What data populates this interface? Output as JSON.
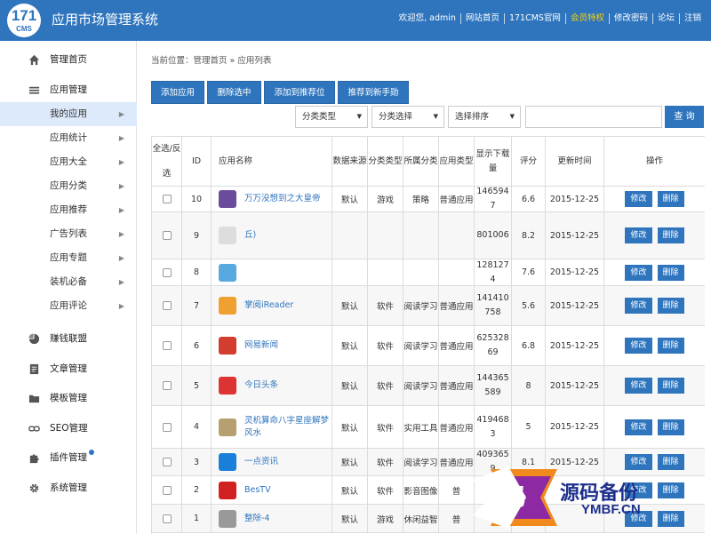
{
  "header": {
    "logo_number": "171",
    "logo_sub": "CMS",
    "title": "应用市场管理系统",
    "nav": [
      "欢迎您, admin",
      "网站首页",
      "171CMS官网",
      "会员特权",
      "修改密码",
      "论坛",
      "注销"
    ]
  },
  "sidebar": {
    "items": [
      {
        "label": "管理首页",
        "icon": "home-icon"
      },
      {
        "label": "应用管理",
        "icon": "menu-icon"
      },
      {
        "label": "我的应用"
      },
      {
        "label": "应用统计"
      },
      {
        "label": "应用大全"
      },
      {
        "label": "应用分类"
      },
      {
        "label": "应用推荐"
      },
      {
        "label": "广告列表"
      },
      {
        "label": "应用专题"
      },
      {
        "label": "装机必备"
      },
      {
        "label": "应用评论"
      },
      {
        "label": "赚钱联盟",
        "icon": "pie-chart-icon"
      },
      {
        "label": "文章管理",
        "icon": "document-icon"
      },
      {
        "label": "模板管理",
        "icon": "folder-icon"
      },
      {
        "label": "SEO管理",
        "icon": "link-icon"
      },
      {
        "label": "插件管理",
        "icon": "puzzle-icon"
      },
      {
        "label": "系统管理",
        "icon": "gear-icon"
      }
    ]
  },
  "breadcrumb": "当前位置：管理首页 » 应用列表",
  "toolbar": {
    "add": "添加应用",
    "delete_selected": "删除选中",
    "add_recommend": "添加到推荐位",
    "recommend_newbie": "推荐到新手勋"
  },
  "filters": {
    "category_type": "分类类型",
    "category_select": "分类选择",
    "sort_select": "选择排序",
    "search": "查 询"
  },
  "table": {
    "select_all": "全选/反选",
    "headers": [
      "ID",
      "应用名称",
      "数据来源",
      "分类类型",
      "所属分类",
      "应用类型",
      "显示下载量",
      "评分",
      "更新时间",
      "操作"
    ],
    "edit": "修改",
    "delete": "删除",
    "rows": [
      {
        "id": "10",
        "name": "万万没想到之大皇帝",
        "source": "默认",
        "ctype": "游戏",
        "cat": "策略",
        "atype": "普通应用",
        "downloads": "1465947",
        "score": "6.6",
        "date": "2015-12-25"
      },
      {
        "id": "9",
        "name": "丘)",
        "source": "",
        "ctype": "",
        "cat": "",
        "atype": "",
        "downloads": "801006",
        "score": "8.2",
        "date": "2015-12-25"
      },
      {
        "id": "8",
        "name": "",
        "source": "",
        "ctype": "",
        "cat": "",
        "atype": "",
        "downloads": "1281274",
        "score": "7.6",
        "date": "2015-12-25"
      },
      {
        "id": "7",
        "name": "掌阅iReader",
        "source": "默认",
        "ctype": "软件",
        "cat": "阅读学习",
        "atype": "普通应用",
        "downloads": "141410758",
        "score": "5.6",
        "date": "2015-12-25"
      },
      {
        "id": "6",
        "name": "网易新闻",
        "source": "默认",
        "ctype": "软件",
        "cat": "阅读学习",
        "atype": "普通应用",
        "downloads": "62532869",
        "score": "6.8",
        "date": "2015-12-25"
      },
      {
        "id": "5",
        "name": "今日头条",
        "source": "默认",
        "ctype": "软件",
        "cat": "阅读学习",
        "atype": "普通应用",
        "downloads": "144365589",
        "score": "8",
        "date": "2015-12-25"
      },
      {
        "id": "4",
        "name": "灵机算命八字星座解梦风水",
        "source": "默认",
        "ctype": "软件",
        "cat": "实用工具",
        "atype": "普通应用",
        "downloads": "4194683",
        "score": "5",
        "date": "2015-12-25"
      },
      {
        "id": "3",
        "name": "一点资讯",
        "source": "默认",
        "ctype": "软件",
        "cat": "阅读学习",
        "atype": "普通应用",
        "downloads": "4093659",
        "score": "8.1",
        "date": "2015-12-25"
      },
      {
        "id": "2",
        "name": "BesTV",
        "source": "默认",
        "ctype": "软件",
        "cat": "影音图像",
        "atype": "普",
        "downloads": "",
        "score": "",
        "date": ""
      },
      {
        "id": "1",
        "name": "整除-4",
        "source": "默认",
        "ctype": "游戏",
        "cat": "休闲益智",
        "atype": "普",
        "downloads": "",
        "score": "",
        "date": ""
      }
    ]
  },
  "watermark": {
    "glyph": "码",
    "text": "源码备份",
    "domain": "YMBF.CN"
  },
  "colors": {
    "primary": "#2f75bd",
    "vip": "#ffd200",
    "active_bg": "#ddeafb"
  }
}
